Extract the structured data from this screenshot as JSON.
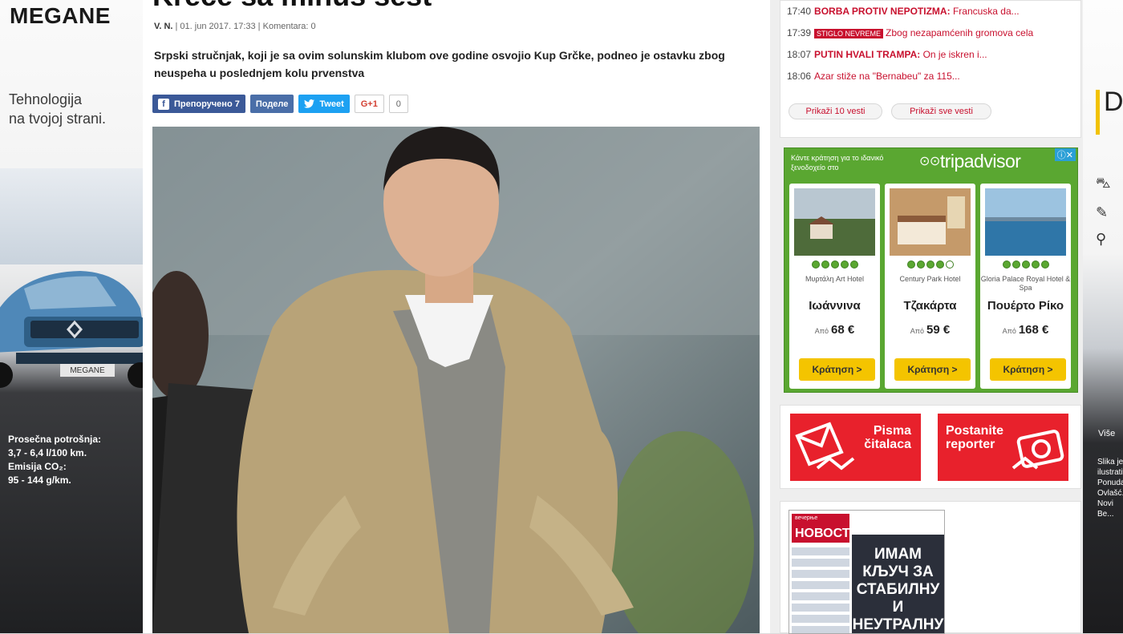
{
  "left_ad": {
    "brand": "MEGANE",
    "tagline_1": "Tehnologija",
    "tagline_2": "na tvojoj strani.",
    "plate": "MEGANE",
    "fine_1": "Prosečna potrošnja:",
    "fine_2": "3,7 - 6,4 l/100 km.",
    "fine_3": "Emisija CO₂:",
    "fine_4": "95 - 144 g/km."
  },
  "right_ad": {
    "letter": "D",
    "more": "Više",
    "text": "Slika je ilustrativna. Ponuda... Ovlašć... Novi Be..."
  },
  "article": {
    "title": "Kreće sa minus šest",
    "author": "V. N.",
    "date": "| 01. jun 2017. 17:33 |",
    "comments": "Komentara: 0",
    "lead": "Srpski stručnjak, koji je sa ovim solunskim klubom ove godine osvojio Kup Grčke, podneo je ostavku zbog neuspeha u poslednjem kolu prvenstva"
  },
  "share": {
    "facebook": "Препоручено 7",
    "vk": "Поделе",
    "twitter": "Tweet",
    "gplus": "G+1",
    "gplus_count": "0"
  },
  "news": {
    "items": [
      {
        "time": "17:40",
        "headline": "BORBA PROTIV NEPOTIZMA:",
        "rest": "Francuska da...",
        "badge": ""
      },
      {
        "time": "17:39",
        "headline": "",
        "rest": "Zbog nezapamćenih gromova cela",
        "badge": "STIGLO NEVREME"
      },
      {
        "time": "18:07",
        "headline": "PUTIN HVALI TRAMPA:",
        "rest": "On je iskren i...",
        "badge": ""
      },
      {
        "time": "18:06",
        "headline": "",
        "rest": "Azar stiže na \"Bernabeu\" za 115...",
        "badge": ""
      }
    ],
    "btn_10": "Prikaži 10 vesti",
    "btn_all": "Prikaži sve vesti"
  },
  "tripadvisor": {
    "header": "Κάντε κράτηση για το ιδανικό ξενοδοχείο στο",
    "logo": "tripadvisor",
    "close": "ⓘ✕",
    "hotels": [
      {
        "name": "Μυρτάλη Art Hotel",
        "city": "Ιωάννινα",
        "from": "Από",
        "price": "68 €",
        "book": "Κράτηση >",
        "rating": 5
      },
      {
        "name": "Century Park Hotel",
        "city": "Τζακάρτα",
        "from": "Από",
        "price": "59 €",
        "book": "Κράτηση >",
        "rating": 4
      },
      {
        "name": "Gloria Palace Royal Hotel & Spa",
        "city": "Πουέρτο Ρίκο",
        "from": "Από",
        "price": "168 €",
        "book": "Κράτηση >",
        "rating": 5
      }
    ]
  },
  "services": {
    "letters_1": "Pisma",
    "letters_2": "čitalaca",
    "reporter_1": "Postanite",
    "reporter_2": "reporter"
  },
  "newspaper": {
    "pre": "вечерње",
    "masthead": "НОВОСТИ",
    "headline": "ИМАМ КЉУЧ ЗА СТАБИЛНУ И НЕУТРАЛНУ СРБИЈУ"
  }
}
